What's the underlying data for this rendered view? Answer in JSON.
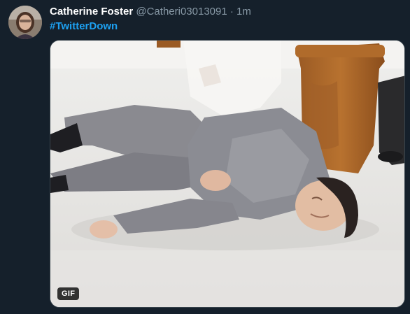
{
  "tweet": {
    "display_name": "Catherine Foster",
    "handle": "@Catheri03013091",
    "separator": "·",
    "time": "1m",
    "hashtag": "#TwitterDown",
    "media": {
      "type": "gif",
      "badge": "GIF",
      "description": "man in grey suit lying on the floor beside a wooden pew"
    }
  },
  "colors": {
    "background": "#15202b",
    "name": "#ffffff",
    "secondary_text": "#8899a6",
    "hashtag": "#1da1f2",
    "border": "#38444d"
  }
}
